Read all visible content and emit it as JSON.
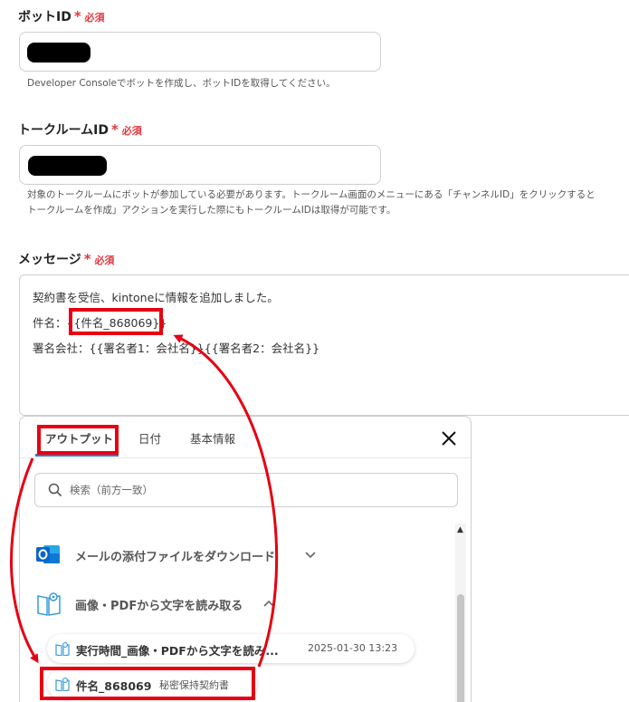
{
  "bot_id": {
    "label": "ボットID",
    "required": "必須",
    "help": "Developer Consoleでボットを作成し、ボットIDを取得してください。"
  },
  "room_id": {
    "label": "トークルームID",
    "required": "必須",
    "help_line1": "対象のトークルームにボットが参加している必要があります。トークルーム画面のメニューにある「チャンネルID」をクリックすると",
    "help_line2": "トークルームを作成」アクションを実行した際にもトークルームIDは取得が可能です。"
  },
  "message": {
    "label": "メッセージ",
    "required": "必須",
    "line1": "契約書を受信、kintoneに情報を追加しました。",
    "line2_prefix": "件名：",
    "line2_var": "{{件名_868069}}",
    "line3": "署名会社：{{署名者1：会社名}}{{署名者2：会社名}}"
  },
  "output_panel": {
    "tabs": [
      "アウトプット",
      "日付",
      "基本情報"
    ],
    "search_placeholder": "検索（前方一致）",
    "groups": [
      {
        "label": "メールの添付ファイルをダウンロード",
        "icon": "outlook-icon",
        "expanded": false
      },
      {
        "label": "画像・PDFから文字を読み取る",
        "icon": "book-icon",
        "expanded": true
      }
    ],
    "items": [
      {
        "name": "実行時間_画像・PDFから文字を読み...",
        "value": "2025-01-30 13:23"
      },
      {
        "name": "件名_868069",
        "value": "秘密保持契約書"
      }
    ]
  },
  "colors": {
    "required": "#e0383e",
    "highlight": "#e60012",
    "tab_accent": "#2b7bd7",
    "outlook": "#0a64c8"
  }
}
